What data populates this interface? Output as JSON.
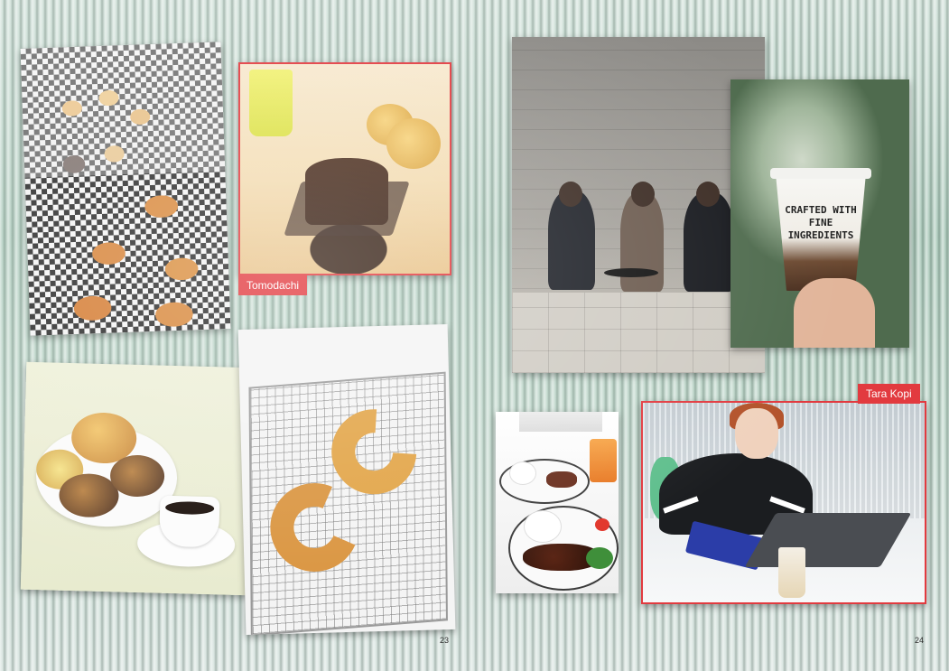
{
  "labels": {
    "tomodachi": "Tomodachi",
    "tara_kopi": "Tara Kopi"
  },
  "cup_print": {
    "line1": "CRAFTED WITH",
    "line2": "FINE INGREDIENTS"
  },
  "page_numbers": {
    "left": "23",
    "right": "24"
  },
  "colors": {
    "accent": "#e23a3f",
    "label_text": "#ffffff",
    "background_glass": "#b9d3c6"
  }
}
